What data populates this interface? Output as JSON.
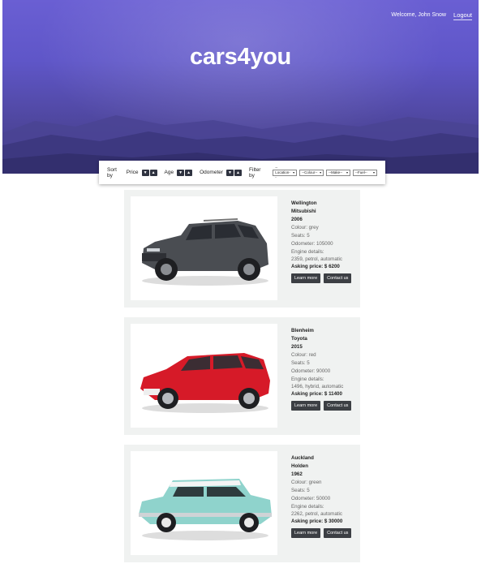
{
  "header": {
    "welcome": "Welcome, John Snow",
    "logout": "Logout",
    "brand": "cars4you"
  },
  "toolbar": {
    "sort_by": "Sort by",
    "price": "Price",
    "age": "Age",
    "odometer": "Odometer",
    "filter_by": "Filter by",
    "filters": [
      "--Location--",
      "--Colour--",
      "--Make--",
      "--Fuel--"
    ]
  },
  "listings": [
    {
      "location": "Wellington",
      "make": "Mitsubishi",
      "year": "2006",
      "colour": "Colour: grey",
      "seats": "Seats: 5",
      "odometer": "Odometer: 105000",
      "engine_label": "Engine details:",
      "engine": "2359, petrol, automatic",
      "price": "Asking price: $ 6200",
      "learn": "Learn more",
      "contact": "Contact us"
    },
    {
      "location": "Blenheim",
      "make": "Toyota",
      "year": "2015",
      "colour": "Colour: red",
      "seats": "Seats: 5",
      "odometer": "Odometer: 90000",
      "engine_label": "Engine details:",
      "engine": "1496, hybrid, automatic",
      "price": "Asking price: $ 11400",
      "learn": "Learn more",
      "contact": "Contact us"
    },
    {
      "location": "Auckland",
      "make": "Holden",
      "year": "1962",
      "colour": "Colour: green",
      "seats": "Seats: 5",
      "odometer": "Odometer: 50000",
      "engine_label": "Engine details:",
      "engine": "2262, petrol, automatic",
      "price": "Asking price: $ 30000",
      "learn": "Learn more",
      "contact": "Contact us"
    }
  ],
  "colors": {
    "hero": "#5f56c8",
    "button": "#3c3f44",
    "card": "#f0f2f1"
  }
}
